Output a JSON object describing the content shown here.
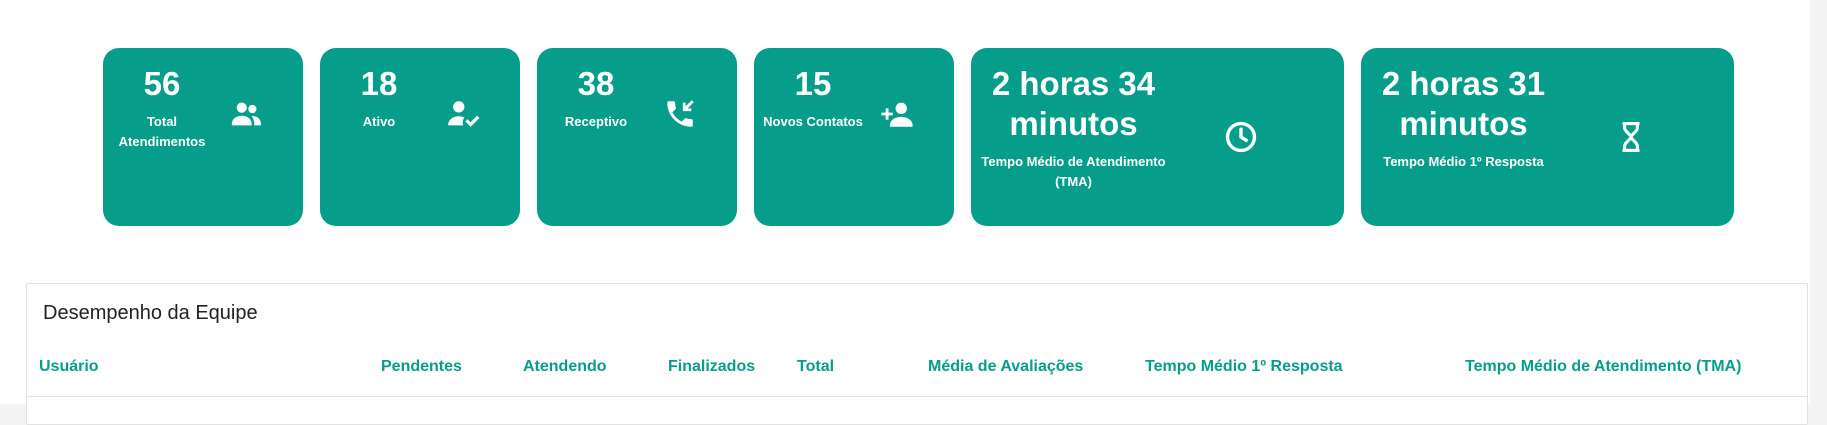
{
  "cards": [
    {
      "value": "56",
      "label": "Total Atendimentos",
      "icon": "users-icon"
    },
    {
      "value": "18",
      "label": "Ativo",
      "icon": "user-check-icon"
    },
    {
      "value": "38",
      "label": "Receptivo",
      "icon": "phone-incoming-icon"
    },
    {
      "value": "15",
      "label": "Novos Contatos",
      "icon": "user-plus-icon"
    },
    {
      "value": "2 horas 34 minutos",
      "label": "Tempo Médio de Atendimento (TMA)",
      "icon": "clock-icon"
    },
    {
      "value": "2 horas 31 minutos",
      "label": "Tempo Médio 1º Resposta",
      "icon": "hourglass-icon"
    }
  ],
  "team": {
    "title": "Desempenho da Equipe",
    "columns": [
      "Usuário",
      "Pendentes",
      "Atendendo",
      "Finalizados",
      "Total",
      "Média de Avaliações",
      "Tempo Médio 1º Resposta",
      "Tempo Médio de Atendimento (TMA)"
    ]
  },
  "colors": {
    "accent": "#069e8b",
    "card_text": "#ffffff"
  }
}
